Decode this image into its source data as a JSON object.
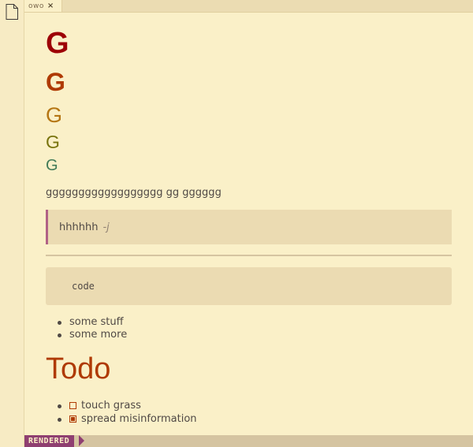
{
  "tab": {
    "label": "owo",
    "close": "×"
  },
  "headings": {
    "h1": "G",
    "h2": "G",
    "h3": "G",
    "h4": "G",
    "h5": "G"
  },
  "paragraph": "gggggggggggggggggg gg gggggg",
  "blockquote": {
    "text": "hhhhhh",
    "attribution": "-j"
  },
  "code": "code",
  "bullets": [
    "some stuff",
    "some more"
  ],
  "todo": {
    "title": "Todo",
    "items": [
      {
        "label": "touch grass",
        "checked": false
      },
      {
        "label": "spread misinformation",
        "checked": true
      }
    ]
  },
  "status": {
    "mode": "RENDERED"
  },
  "colors": {
    "background": "#faf0c8",
    "accent": "#af3a03",
    "h1": "#9d0006",
    "h3": "#b57614",
    "h4": "#79740e",
    "h5": "#427b58",
    "quote_border": "#b16286",
    "mode_badge": "#8f3f71"
  },
  "icons": {
    "file": "file-icon"
  }
}
